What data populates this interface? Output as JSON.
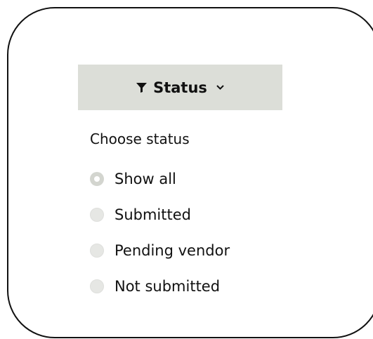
{
  "filter": {
    "label": "Status",
    "icon": "filter-icon",
    "chevron": "chevron-down-icon",
    "header_bg": "#dcded8"
  },
  "panel": {
    "title": "Choose status",
    "options": [
      {
        "label": "Show all",
        "checked": true
      },
      {
        "label": "Submitted",
        "checked": false
      },
      {
        "label": "Pending vendor",
        "checked": false
      },
      {
        "label": "Not submitted",
        "checked": false
      }
    ]
  }
}
